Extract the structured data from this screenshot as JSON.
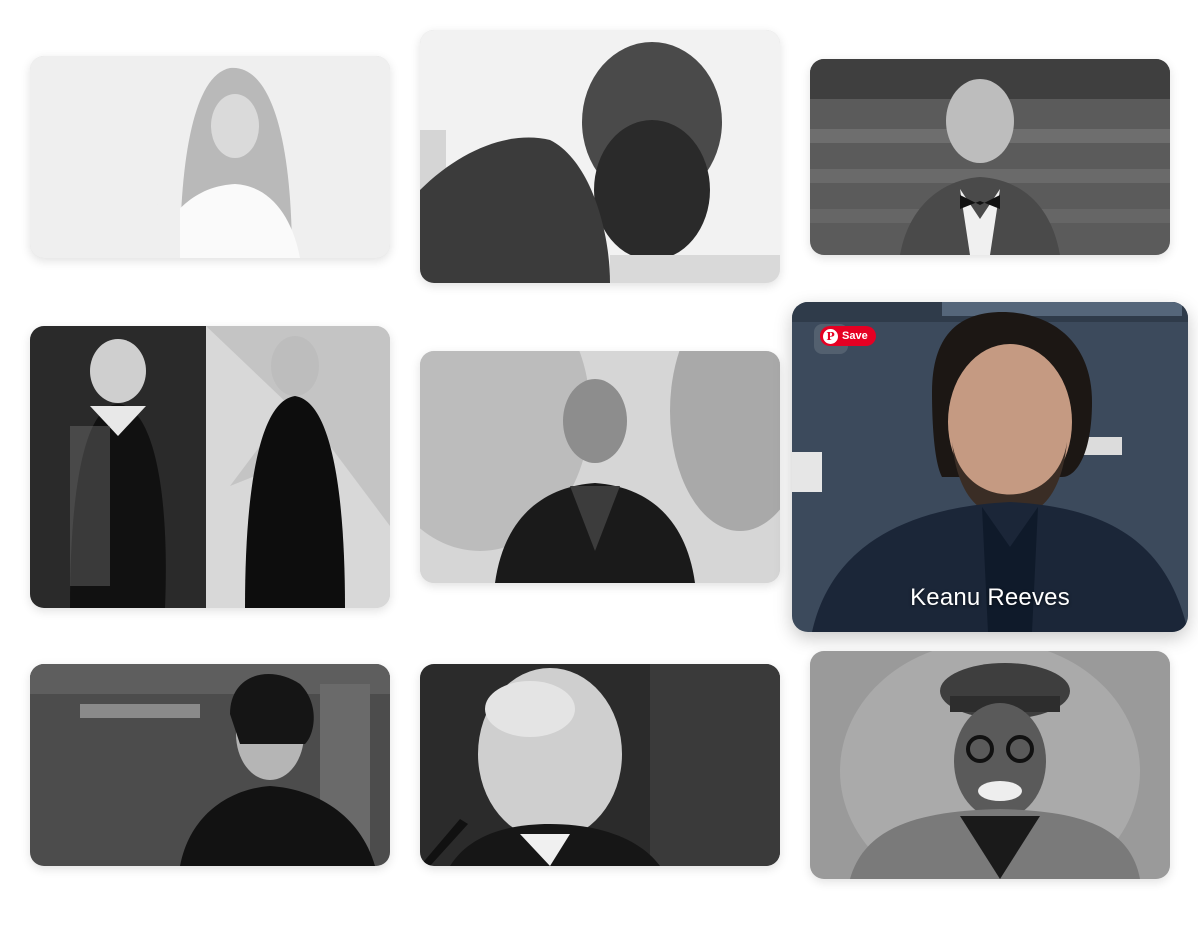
{
  "gallery": {
    "cards": [
      {
        "id": "portrait-1",
        "style": "grayscale"
      },
      {
        "id": "portrait-2",
        "style": "grayscale"
      },
      {
        "id": "portrait-3",
        "style": "grayscale"
      },
      {
        "id": "portrait-4",
        "style": "grayscale"
      },
      {
        "id": "portrait-5",
        "style": "grayscale"
      },
      {
        "id": "portrait-6",
        "style": "color",
        "hovered": true,
        "caption": "Keanu Reeves"
      },
      {
        "id": "portrait-7",
        "style": "grayscale"
      },
      {
        "id": "portrait-8",
        "style": "grayscale"
      },
      {
        "id": "portrait-9",
        "style": "grayscale"
      }
    ],
    "pin_button": {
      "label": "Save",
      "icon": "pinterest-icon",
      "color": "#e60023"
    }
  },
  "colors": {
    "background": "#ffffff",
    "hover_suit": "#1b2638",
    "hover_backdrop": "#3c4a5c"
  }
}
